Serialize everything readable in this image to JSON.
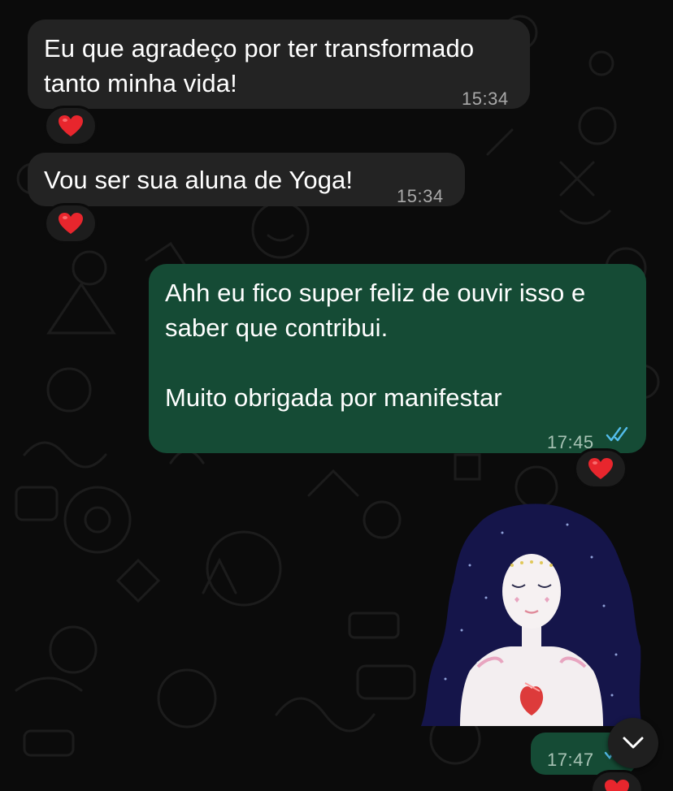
{
  "messages": [
    {
      "direction": "in",
      "text": "Eu que agradeço por ter transformado\ntanto minha vida!",
      "time": "15:34",
      "reaction": "heart"
    },
    {
      "direction": "in",
      "text": "Vou ser sua aluna de Yoga!",
      "time": "15:34",
      "reaction": "heart"
    },
    {
      "direction": "out",
      "text": "Ahh eu fico super feliz de ouvir isso e\nsaber que contribui.\n\nMuito obrigada por manifestar",
      "time": "17:45",
      "status": "read",
      "reaction": "heart"
    },
    {
      "direction": "out",
      "type": "sticker",
      "sticker": "woman-heart-illustration",
      "time": "17:47",
      "status": "read",
      "reaction": "heart"
    }
  ],
  "scroll_button": {
    "icon": "chevron-down-icon"
  },
  "colors": {
    "background": "#0b0b0b",
    "incoming_bubble": "#232323",
    "outgoing_bubble": "#154b35",
    "read_ticks": "#53bdeb",
    "heart": "#e8262d"
  }
}
